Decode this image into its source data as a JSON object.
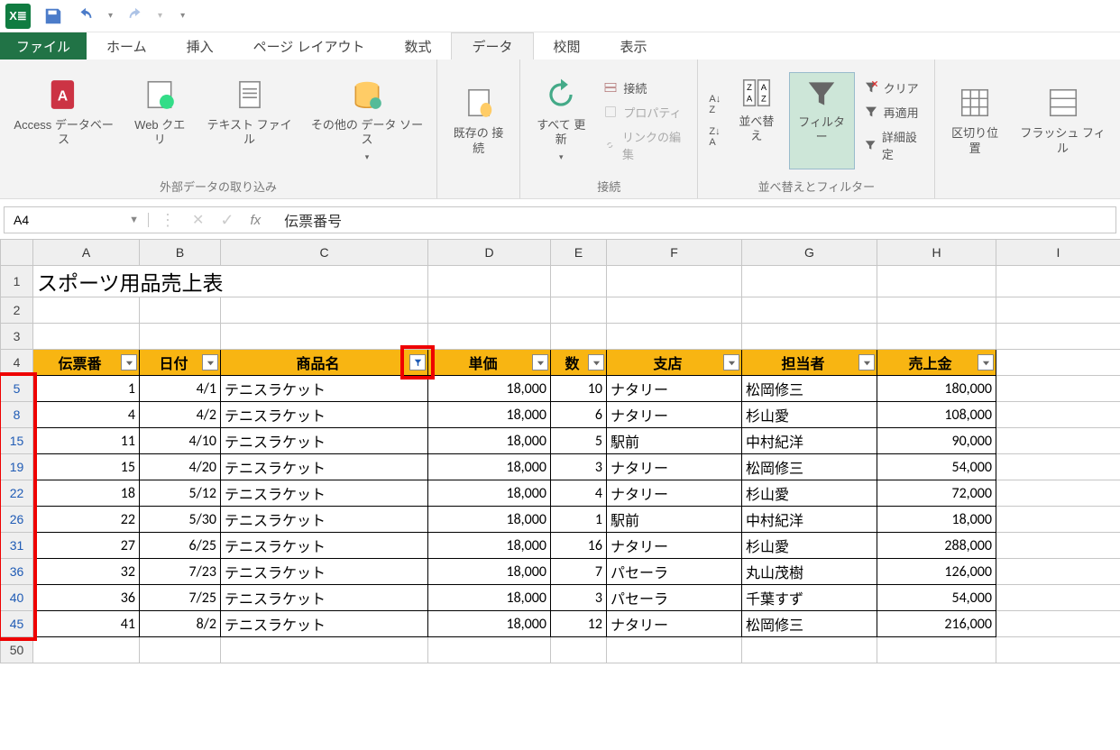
{
  "qat": {
    "save": "save",
    "undo": "undo",
    "redo": "redo"
  },
  "tabs": {
    "file": "ファイル",
    "home": "ホーム",
    "insert": "挿入",
    "layout": "ページ レイアウト",
    "formulas": "数式",
    "data": "データ",
    "review": "校閲",
    "view": "表示"
  },
  "ribbon": {
    "group1": {
      "access": "Access\nデータベース",
      "web": "Web\nクエリ",
      "text": "テキスト\nファイル",
      "other": "その他の\nデータ ソース",
      "title": "外部データの取り込み"
    },
    "group2": {
      "existing": "既存の\n接続"
    },
    "group3": {
      "refresh": "すべて\n更新",
      "conn": "接続",
      "props": "プロパティ",
      "links": "リンクの編集",
      "title": "接続"
    },
    "group4": {
      "asc": "↓",
      "sortbtn": "並べ替え",
      "filterbtn": "フィルター",
      "clear": "クリア",
      "reapply": "再適用",
      "advanced": "詳細設定",
      "title": "並べ替えとフィルター"
    },
    "group5": {
      "texttocol": "区切り位置",
      "flash": "フラッシュ\nフィル"
    }
  },
  "namebox": "A4",
  "formula": "伝票番号",
  "columns": [
    "A",
    "B",
    "C",
    "D",
    "E",
    "F",
    "G",
    "H",
    "I"
  ],
  "title_cell": "スポーツ用品売上表",
  "headers": [
    "伝票番",
    "日付",
    "商品名",
    "単価",
    "数",
    "支店",
    "担当者",
    "売上金"
  ],
  "row_nums": [
    "1",
    "2",
    "3",
    "4",
    "5",
    "8",
    "15",
    "19",
    "22",
    "26",
    "31",
    "36",
    "40",
    "45",
    "50"
  ],
  "rows": [
    {
      "a": "1",
      "b": "4/1",
      "c": "テニスラケット",
      "d": "18,000",
      "e": "10",
      "f": "ナタリー",
      "g": "松岡修三",
      "h": "180,000"
    },
    {
      "a": "4",
      "b": "4/2",
      "c": "テニスラケット",
      "d": "18,000",
      "e": "6",
      "f": "ナタリー",
      "g": "杉山愛",
      "h": "108,000"
    },
    {
      "a": "11",
      "b": "4/10",
      "c": "テニスラケット",
      "d": "18,000",
      "e": "5",
      "f": "駅前",
      "g": "中村紀洋",
      "h": "90,000"
    },
    {
      "a": "15",
      "b": "4/20",
      "c": "テニスラケット",
      "d": "18,000",
      "e": "3",
      "f": "ナタリー",
      "g": "松岡修三",
      "h": "54,000"
    },
    {
      "a": "18",
      "b": "5/12",
      "c": "テニスラケット",
      "d": "18,000",
      "e": "4",
      "f": "ナタリー",
      "g": "杉山愛",
      "h": "72,000"
    },
    {
      "a": "22",
      "b": "5/30",
      "c": "テニスラケット",
      "d": "18,000",
      "e": "1",
      "f": "駅前",
      "g": "中村紀洋",
      "h": "18,000"
    },
    {
      "a": "27",
      "b": "6/25",
      "c": "テニスラケット",
      "d": "18,000",
      "e": "16",
      "f": "ナタリー",
      "g": "杉山愛",
      "h": "288,000"
    },
    {
      "a": "32",
      "b": "7/23",
      "c": "テニスラケット",
      "d": "18,000",
      "e": "7",
      "f": "パセーラ",
      "g": "丸山茂樹",
      "h": "126,000"
    },
    {
      "a": "36",
      "b": "7/25",
      "c": "テニスラケット",
      "d": "18,000",
      "e": "3",
      "f": "パセーラ",
      "g": "千葉すず",
      "h": "54,000"
    },
    {
      "a": "41",
      "b": "8/2",
      "c": "テニスラケット",
      "d": "18,000",
      "e": "12",
      "f": "ナタリー",
      "g": "松岡修三",
      "h": "216,000"
    }
  ]
}
